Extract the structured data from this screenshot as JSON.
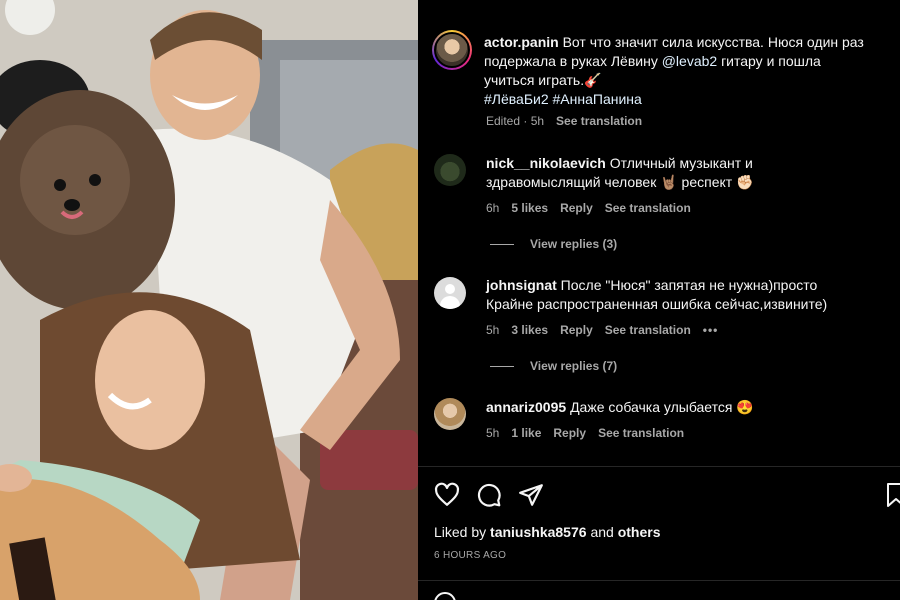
{
  "post": {
    "author": "actor.panin",
    "caption_text": "Вот что значит сила искусства. Нюся один раз подержала в руках Лёвину",
    "mention": "@levab2",
    "caption_line2_tail": "гитару и пошла",
    "caption_line3": "учиться играть.🎸",
    "hashtag1": "#ЛёваБи2",
    "hashtag2": "#АннаПанина",
    "edited": "Edited · 5h",
    "see_translation": "See translation"
  },
  "comments": [
    {
      "username": "nick__nikolaevich",
      "text_line1": "Отличный музыкант и",
      "text_line2": "здравомыслящий человек 🤘🏽 респект ✊🏻",
      "time": "6h",
      "likes": "5 likes",
      "reply": "Reply",
      "see_translation": "See translation",
      "view_replies": "View replies (3)"
    },
    {
      "username": "johnsignat",
      "text_line1": "После \"Нюся\" запятая не нужна)просто",
      "text_line2": "Крайне распространенная ошибка сейчас,извините)",
      "time": "5h",
      "likes": "3 likes",
      "reply": "Reply",
      "see_translation": "See translation",
      "more": "•••",
      "view_replies": "View replies (7)"
    },
    {
      "username": "annariz0095",
      "text_line1": "Даже собачка улыбается 😍",
      "time": "5h",
      "likes": "1 like",
      "reply": "Reply",
      "see_translation": "See translation"
    }
  ],
  "footer": {
    "liked_prefix": "Liked by",
    "liked_user": "taniushka8576",
    "liked_and": "and",
    "liked_others": "others",
    "time_ago": "6 HOURS AGO"
  },
  "icons": {
    "like": "heart-icon",
    "comment": "comment-icon",
    "share": "share-icon",
    "save": "bookmark-icon"
  }
}
